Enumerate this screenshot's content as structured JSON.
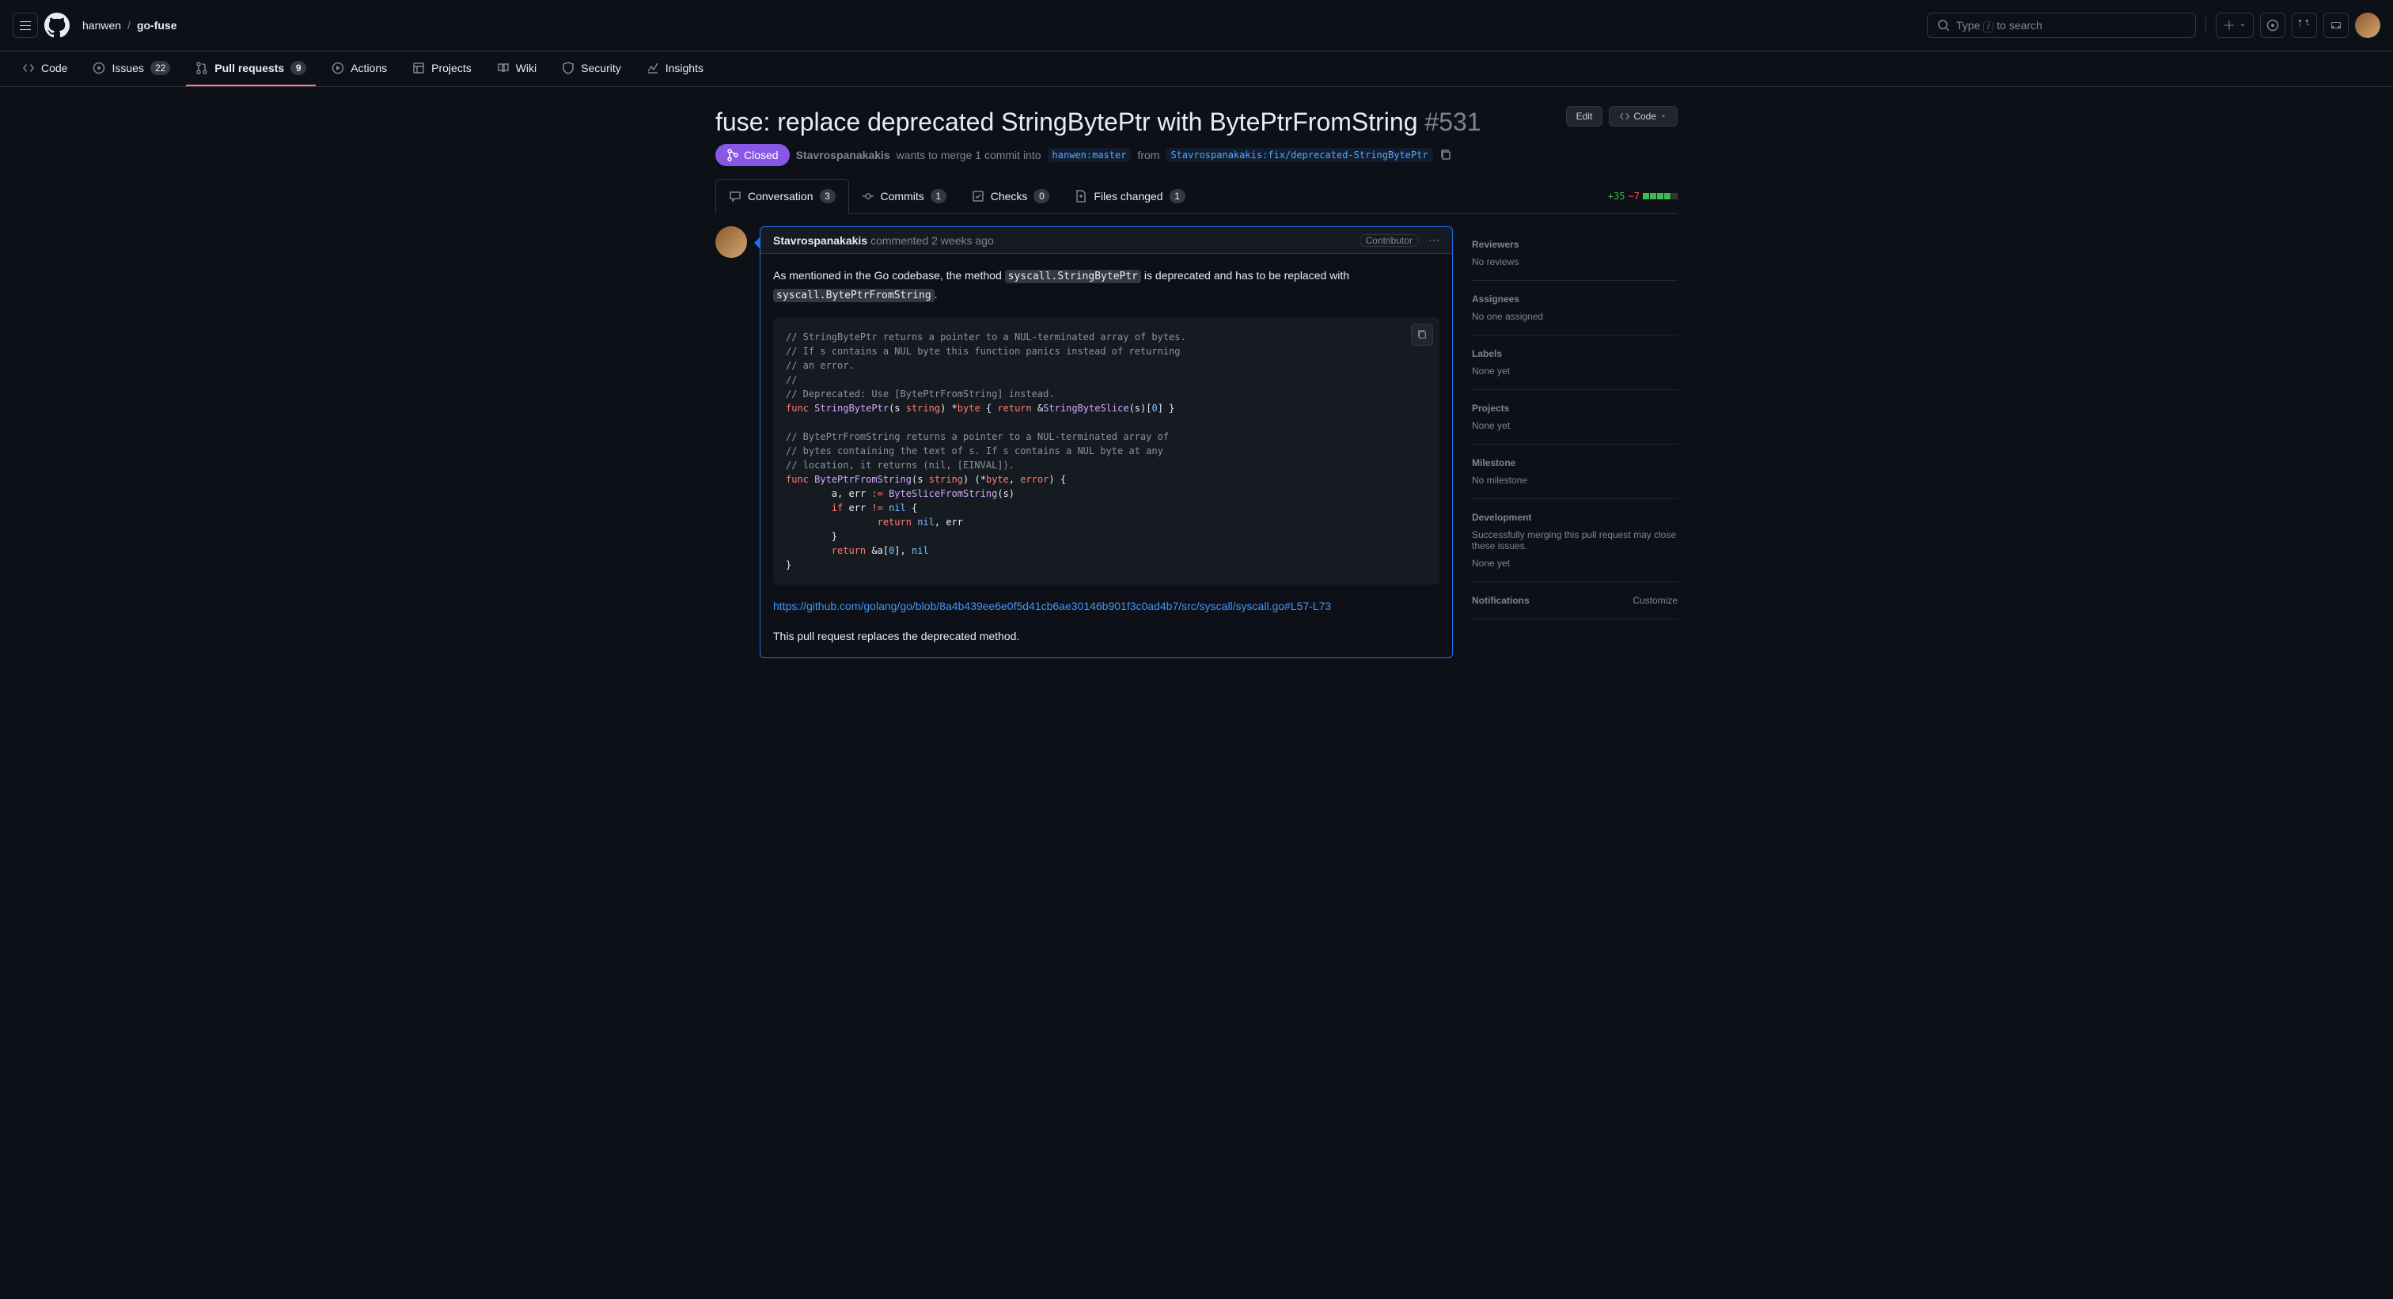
{
  "header": {
    "owner": "hanwen",
    "repo": "go-fuse",
    "search_placeholder": "Type / to search"
  },
  "repo_nav": {
    "code": "Code",
    "issues": "Issues",
    "issues_count": "22",
    "pulls": "Pull requests",
    "pulls_count": "9",
    "actions": "Actions",
    "projects": "Projects",
    "wiki": "Wiki",
    "security": "Security",
    "insights": "Insights"
  },
  "pr": {
    "title": "fuse: replace deprecated StringBytePtr with BytePtrFromString",
    "number": "#531",
    "edit_label": "Edit",
    "code_label": "Code",
    "status": "Closed",
    "author": "Stavrospanakakis",
    "wants": "wants to merge 1 commit into",
    "base_branch": "hanwen:master",
    "from": "from",
    "head_branch": "Stavrospanakakis:fix/deprecated-StringBytePtr"
  },
  "tabs": {
    "conversation": "Conversation",
    "conversation_count": "3",
    "commits": "Commits",
    "commits_count": "1",
    "checks": "Checks",
    "checks_count": "0",
    "files": "Files changed",
    "files_count": "1",
    "diff_add": "+35",
    "diff_del": "−7"
  },
  "comment": {
    "author": "Stavrospanakakis",
    "verb": "commented",
    "time": "2 weeks ago",
    "badge": "Contributor",
    "text1": "As mentioned in the Go codebase, the method",
    "code1": "syscall.StringBytePtr",
    "text2": "is deprecated and has to be replaced with",
    "code2": "syscall.BytePtrFromString",
    "text3": ".",
    "link": "https://github.com/golang/go/blob/8a4b439ee6e0f5d41cb6ae30146b901f3c0ad4b7/src/syscall/syscall.go#L57-L73",
    "text4": "This pull request replaces the deprecated method."
  },
  "codeblock": {
    "l1": "// StringBytePtr returns a pointer to a NUL-terminated array of bytes.",
    "l2": "// If s contains a NUL byte this function panics instead of returning",
    "l3": "// an error.",
    "l4": "//",
    "l5": "// Deprecated: Use [BytePtrFromString] instead.",
    "l6a": "func",
    "l6b": "StringBytePtr",
    "l6c": "(s ",
    "l6d": "string",
    "l6e": ") *",
    "l6f": "byte",
    "l6g": " { ",
    "l6h": "return",
    "l6i": " &",
    "l6j": "StringByteSlice",
    "l6k": "(s)[",
    "l6l": "0",
    "l6m": "] }",
    "l7": "",
    "l8": "// BytePtrFromString returns a pointer to a NUL-terminated array of",
    "l9": "// bytes containing the text of s. If s contains a NUL byte at any",
    "l10": "// location, it returns (nil, [EINVAL]).",
    "l11a": "func",
    "l11b": "BytePtrFromString",
    "l11c": "(s ",
    "l11d": "string",
    "l11e": ") (*",
    "l11f": "byte",
    "l11g": ", ",
    "l11h": "error",
    "l11i": ") {",
    "l12a": "        a, err ",
    "l12b": ":=",
    "l12c": " ",
    "l12d": "ByteSliceFromString",
    "l12e": "(s)",
    "l13a": "        ",
    "l13b": "if",
    "l13c": " err ",
    "l13d": "!=",
    "l13e": " ",
    "l13f": "nil",
    "l13g": " {",
    "l14a": "                ",
    "l14b": "return",
    "l14c": " ",
    "l14d": "nil",
    "l14e": ", err",
    "l15": "        }",
    "l16a": "        ",
    "l16b": "return",
    "l16c": " &a[",
    "l16d": "0",
    "l16e": "], ",
    "l16f": "nil",
    "l17": "}"
  },
  "sidebar": {
    "reviewers": "Reviewers",
    "reviewers_val": "No reviews",
    "assignees": "Assignees",
    "assignees_val": "No one assigned",
    "labels": "Labels",
    "labels_val": "None yet",
    "projects": "Projects",
    "projects_val": "None yet",
    "milestone": "Milestone",
    "milestone_val": "No milestone",
    "development": "Development",
    "development_val": "Successfully merging this pull request may close these issues.",
    "development_none": "None yet",
    "notifications": "Notifications",
    "customize": "Customize"
  }
}
